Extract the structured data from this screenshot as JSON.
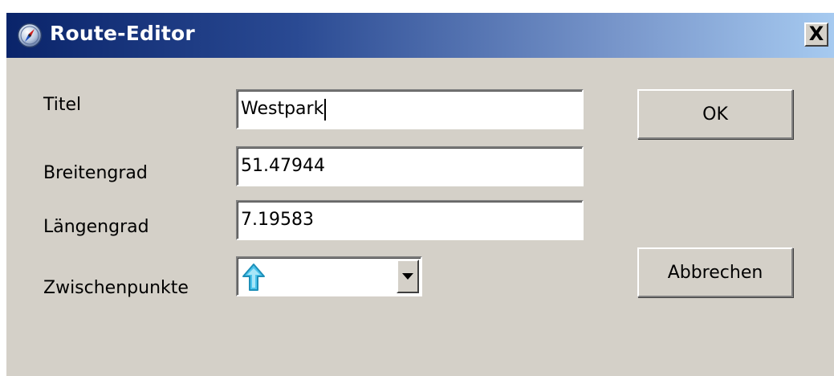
{
  "window": {
    "title": "Route-Editor",
    "close_label": "X",
    "title_icon": "compass-icon"
  },
  "form": {
    "title_label": "Titel",
    "title_value": "Westpark",
    "latitude_label": "Breitengrad",
    "latitude_value": "51.47944",
    "longitude_label": "Längengrad",
    "longitude_value": "7.19583",
    "waypoints_label": "Zwischenpunkte",
    "waypoints_selected_icon": "arrow-up-icon"
  },
  "buttons": {
    "ok_label": "OK",
    "cancel_label": "Abbrechen"
  },
  "colors": {
    "titlebar_start": "#0a246a",
    "titlebar_end": "#a6caf0",
    "window_bg": "#d4d0c8",
    "arrow_icon": "#4cc4ec"
  }
}
